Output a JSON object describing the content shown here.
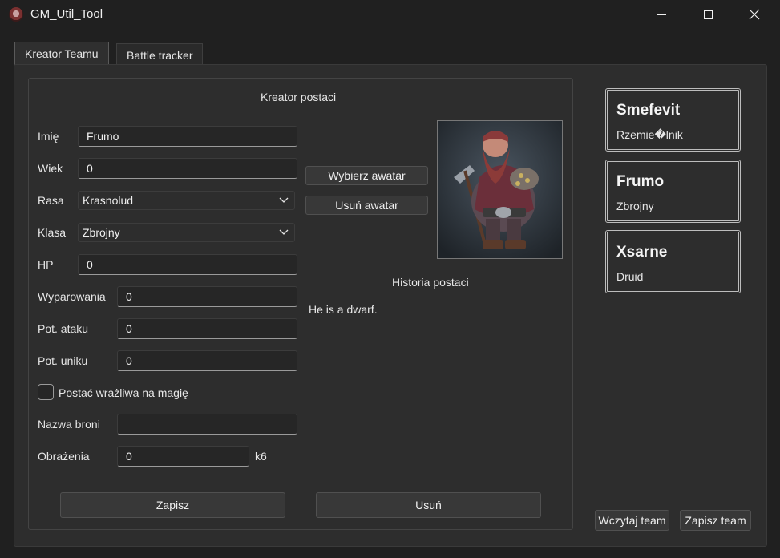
{
  "window": {
    "title": "GM_Util_Tool"
  },
  "tabs": [
    {
      "label": "Kreator Teamu"
    },
    {
      "label": "Battle tracker"
    }
  ],
  "creator": {
    "title": "Kreator postaci",
    "name": {
      "label": "Imię",
      "value": "Frumo"
    },
    "age": {
      "label": "Wiek",
      "value": "0"
    },
    "race": {
      "label": "Rasa",
      "value": "Krasnolud"
    },
    "class": {
      "label": "Klasa",
      "value": "Zbrojny"
    },
    "hp": {
      "label": "HP",
      "value": "0"
    },
    "evasions": {
      "label": "Wyparowania",
      "value": "0"
    },
    "attack_pot": {
      "label": "Pot. ataku",
      "value": "0"
    },
    "dodge_pot": {
      "label": "Pot. uniku",
      "value": "0"
    },
    "magic_vulnerable": {
      "label": "Postać wrażliwa na magię",
      "checked": false
    },
    "weapon_name": {
      "label": "Nazwa broni",
      "value": ""
    },
    "damage": {
      "label": "Obrażenia",
      "value": "0",
      "suffix": "k6"
    },
    "choose_avatar": "Wybierz awatar",
    "remove_avatar": "Usuń awatar",
    "history_title": "Historia postaci",
    "history_text": "He is a dwarf.",
    "save": "Zapisz",
    "delete": "Usuń"
  },
  "team": [
    {
      "name": "Smefevit",
      "class": "Rzemie�lnik"
    },
    {
      "name": "Frumo",
      "class": "Zbrojny"
    },
    {
      "name": "Xsarne",
      "class": "Druid"
    }
  ],
  "team_actions": {
    "load": "Wczytaj team",
    "save": "Zapisz team"
  }
}
